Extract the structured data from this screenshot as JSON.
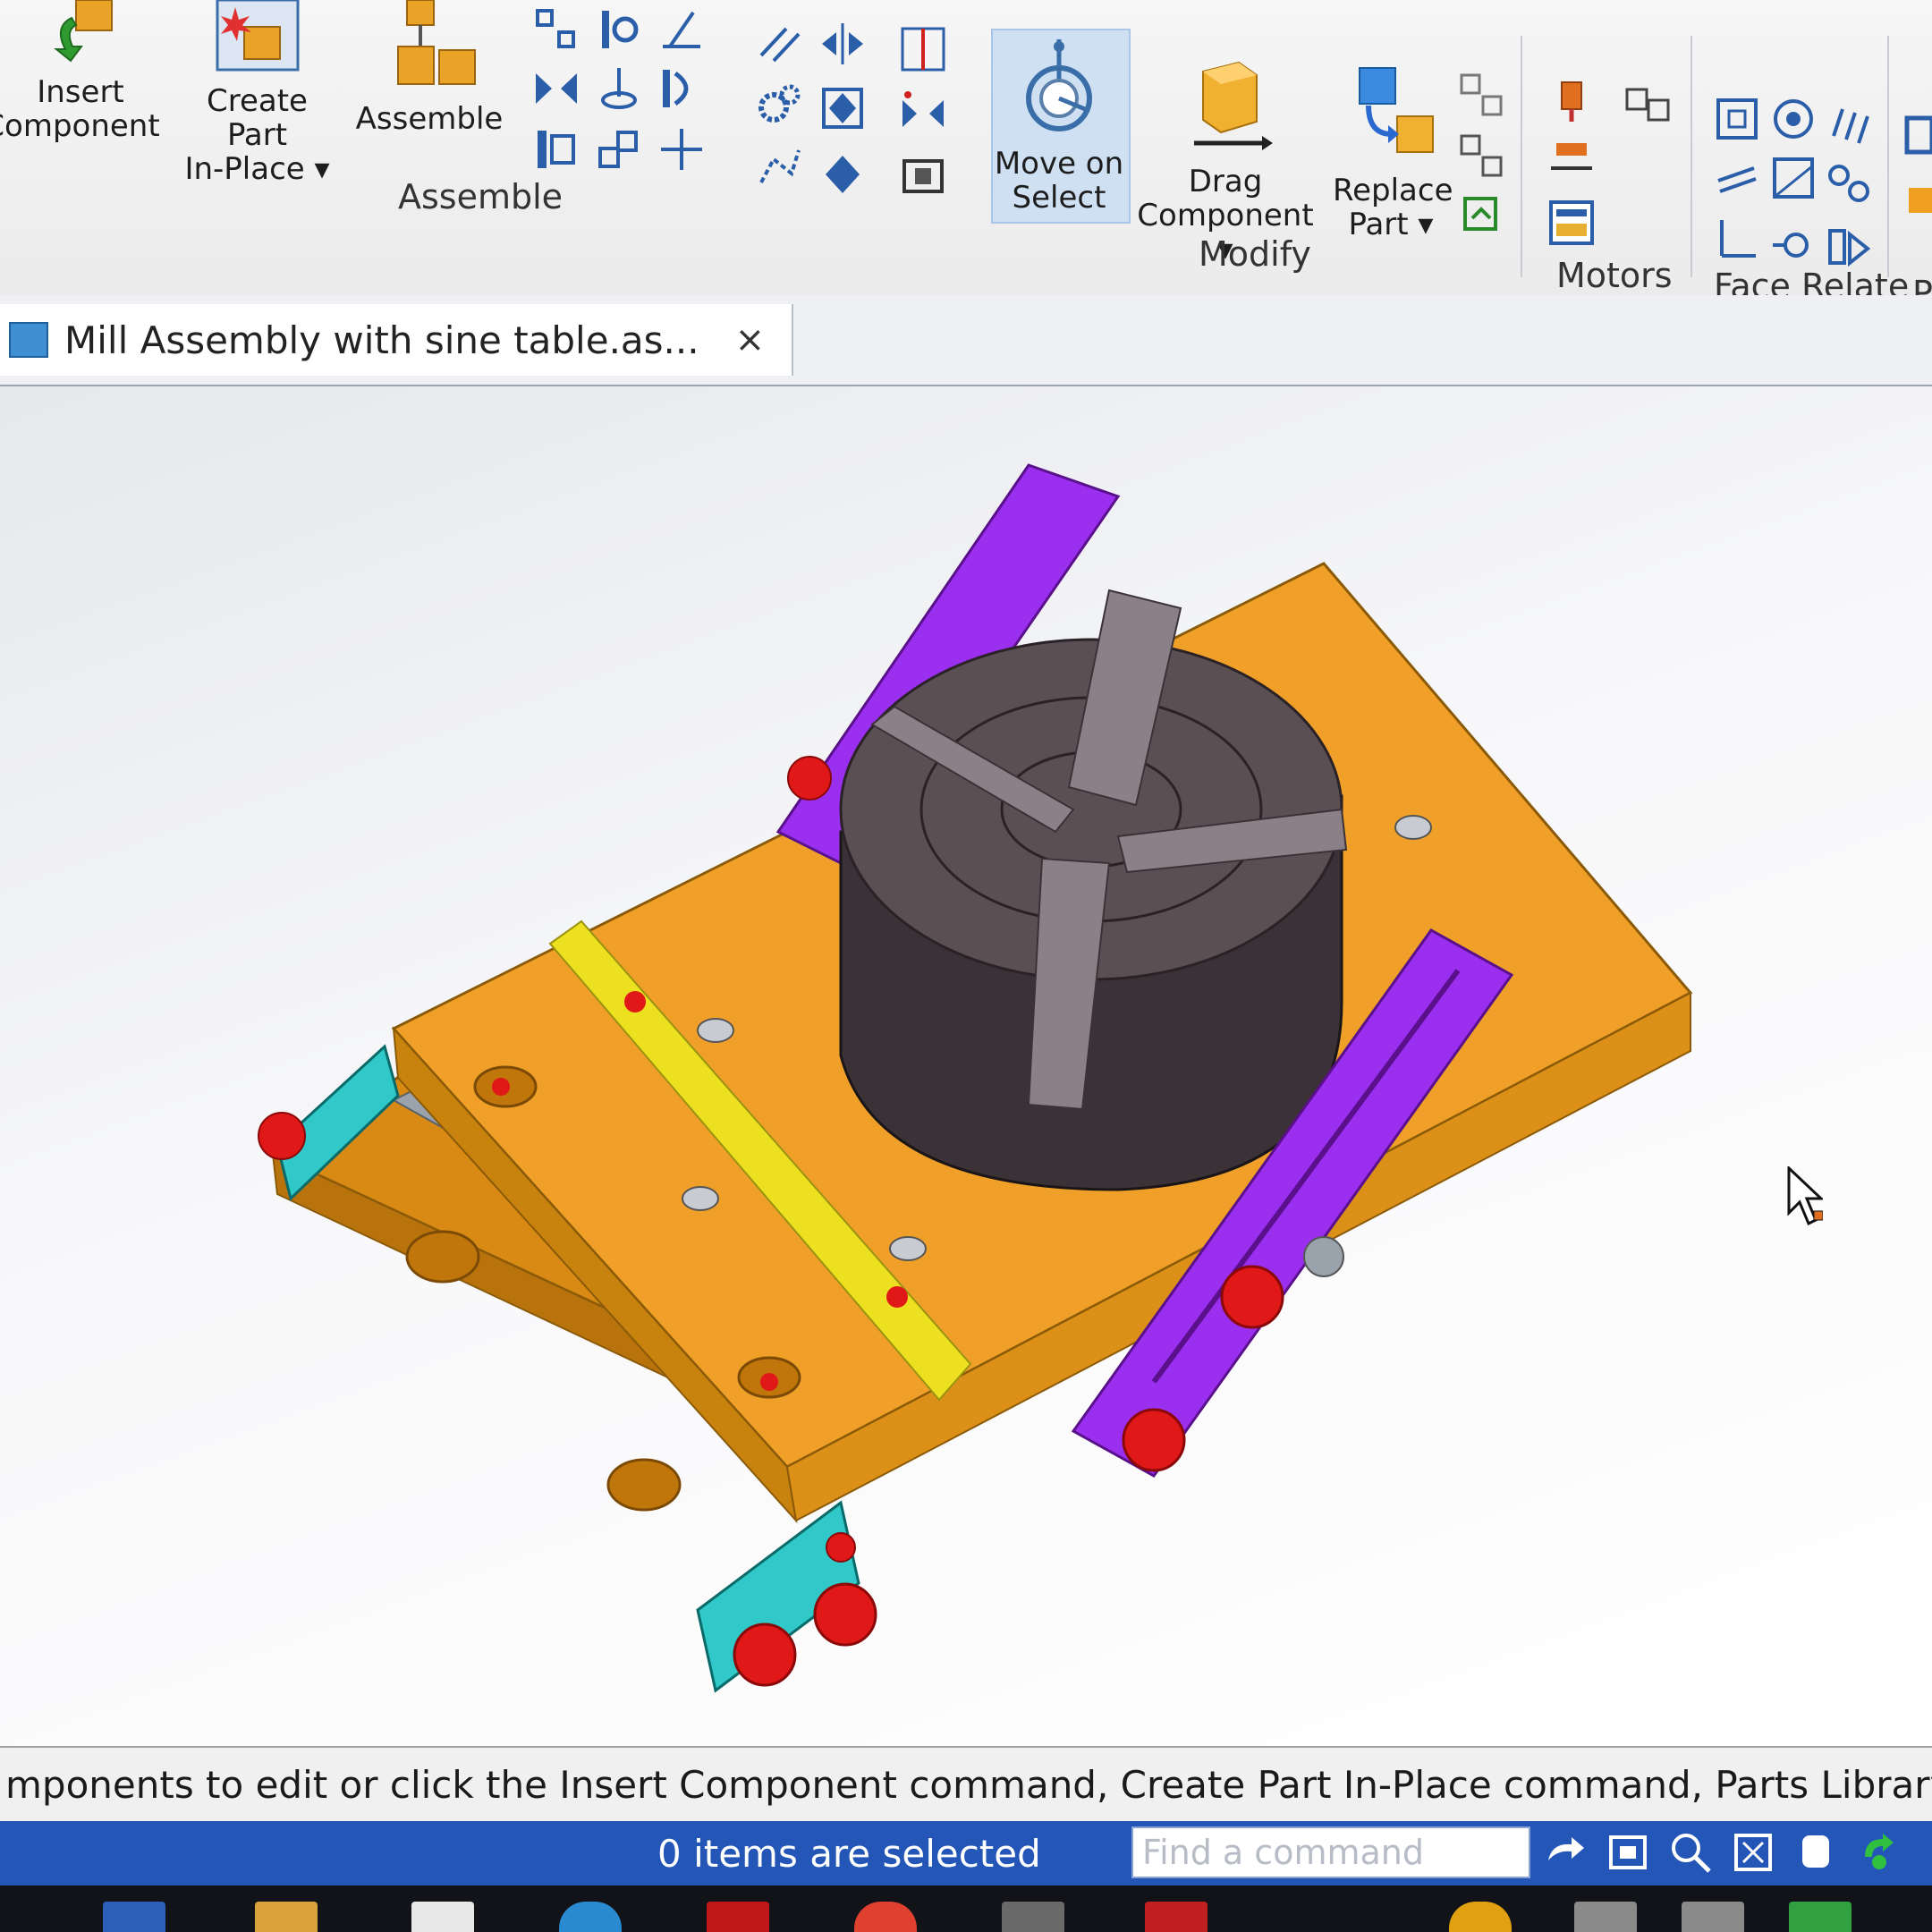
{
  "ribbon": {
    "insert_component": {
      "line1": "Insert",
      "line2": "Component"
    },
    "create_part_in_place": {
      "line1": "Create Part",
      "line2": "In-Place ▾"
    },
    "assemble": "Assemble",
    "move_on_select": {
      "line1": "Move on",
      "line2": "Select"
    },
    "drag_component": {
      "line1": "Drag",
      "line2": "Component ▾"
    },
    "replace_part": {
      "line1": "Replace",
      "line2": "Part ▾"
    },
    "groups": {
      "assemble": "Assemble",
      "modify": "Modify",
      "motors": "Motors",
      "face_relate": "Face Relate",
      "partial": "P"
    }
  },
  "document_tab": {
    "title": "Mill Assembly with sine table.as...",
    "close": "×"
  },
  "prompt_text": "mponents to edit or click the Insert Component command, Create Part In-Place command, Parts Library tab or dra",
  "status": {
    "selection": "0 items are selected",
    "find_placeholder": "Find a command"
  },
  "colors": {
    "base_plate": "#e89a1e",
    "chuck": "#3a3236",
    "jaws": "#8c8088",
    "arms": "#9a2ff0",
    "keys": "#e8e020",
    "caps": "#e01818",
    "end_blocks": "#30c8c8",
    "status_bar": "#2356b6"
  }
}
